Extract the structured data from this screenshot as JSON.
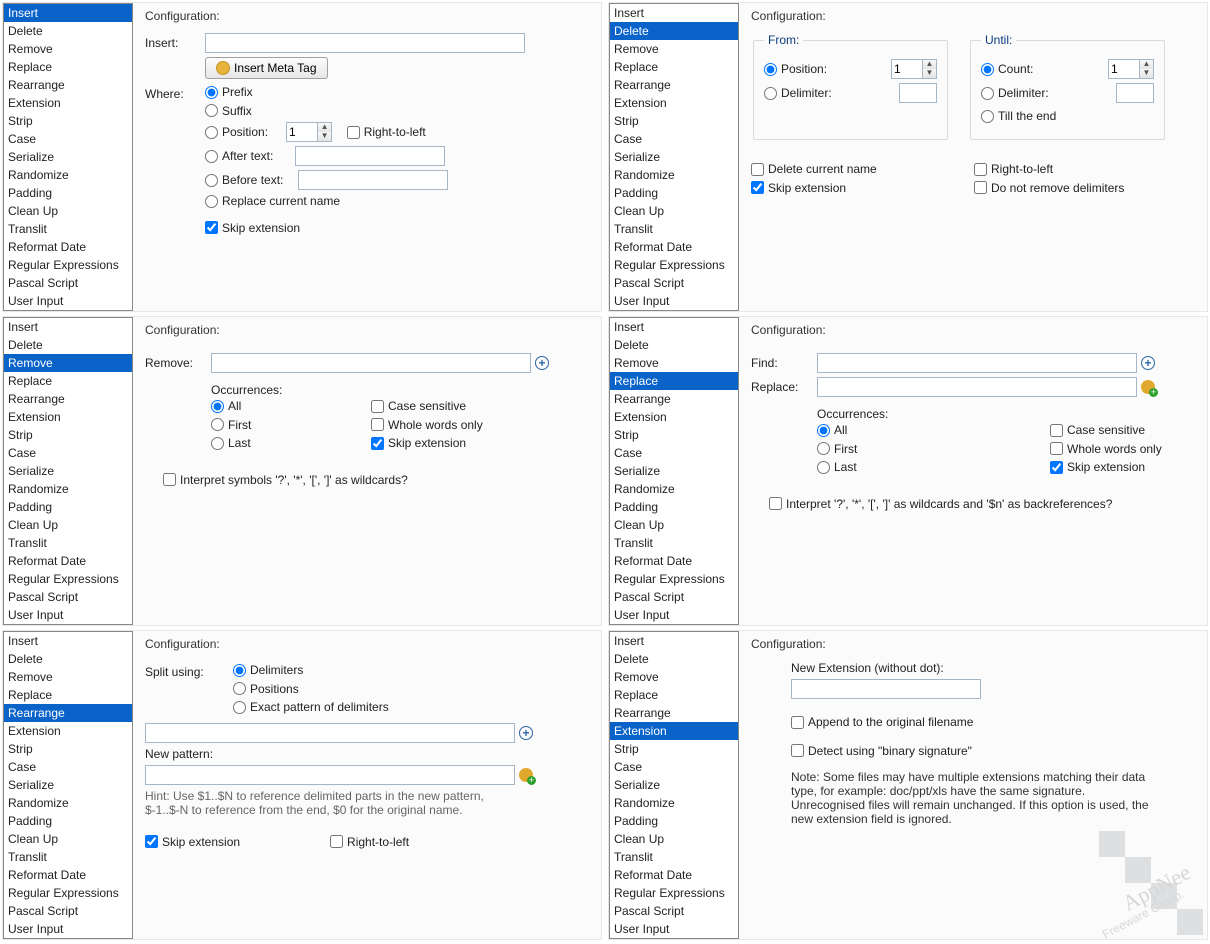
{
  "rule_items": [
    "Insert",
    "Delete",
    "Remove",
    "Replace",
    "Rearrange",
    "Extension",
    "Strip",
    "Case",
    "Serialize",
    "Randomize",
    "Padding",
    "Clean Up",
    "Translit",
    "Reformat Date",
    "Regular Expressions",
    "Pascal Script",
    "User Input"
  ],
  "panels": {
    "insert": {
      "title": "Configuration:",
      "lbl_insert": "Insert:",
      "btn_meta": "Insert Meta Tag",
      "lbl_where": "Where:",
      "opt_prefix": "Prefix",
      "opt_suffix": "Suffix",
      "opt_position": "Position:",
      "pos_val": "1",
      "chk_rtl": "Right-to-left",
      "opt_after": "After text:",
      "opt_before": "Before text:",
      "opt_replace_name": "Replace current name",
      "chk_skip_ext": "Skip extension"
    },
    "delete": {
      "title": "Configuration:",
      "grp_from": "From:",
      "grp_until": "Until:",
      "opt_position": "Position:",
      "from_val": "1",
      "opt_delimiter": "Delimiter:",
      "opt_count": "Count:",
      "until_val": "1",
      "opt_till_end": "Till the end",
      "chk_del_name": "Delete current name",
      "chk_skip_ext": "Skip extension",
      "chk_rtl": "Right-to-left",
      "chk_no_remove_delim": "Do not remove delimiters"
    },
    "remove": {
      "title": "Configuration:",
      "lbl_remove": "Remove:",
      "lbl_occ": "Occurrences:",
      "opt_all": "All",
      "opt_first": "First",
      "opt_last": "Last",
      "chk_case": "Case sensitive",
      "chk_whole": "Whole words only",
      "chk_skip_ext": "Skip extension",
      "chk_wild": "Interpret symbols '?', '*', '[', ']' as wildcards?"
    },
    "replace": {
      "title": "Configuration:",
      "lbl_find": "Find:",
      "lbl_replace": "Replace:",
      "lbl_occ": "Occurrences:",
      "opt_all": "All",
      "opt_first": "First",
      "opt_last": "Last",
      "chk_case": "Case sensitive",
      "chk_whole": "Whole words only",
      "chk_skip_ext": "Skip extension",
      "chk_wild": "Interpret '?', '*', '[', ']' as wildcards and '$n' as backreferences?"
    },
    "rearrange": {
      "title": "Configuration:",
      "lbl_split": "Split using:",
      "opt_delim": "Delimiters",
      "opt_pos": "Positions",
      "opt_exact": "Exact pattern of delimiters",
      "lbl_new": "New pattern:",
      "hint1": "Hint: Use $1..$N to reference delimited parts in the new pattern,",
      "hint2": "$-1..$-N to reference from the end, $0 for the original name.",
      "chk_skip_ext": "Skip extension",
      "chk_rtl": "Right-to-left"
    },
    "extension": {
      "title": "Configuration:",
      "lbl_newext": "New Extension (without dot):",
      "chk_append": "Append to the original filename",
      "chk_detect": "Detect using \"binary signature\"",
      "note": "Note: Some files may have multiple extensions matching their data type, for example: doc/ppt/xls have the same signature. Unrecognised files will remain unchanged. If this option is used, the new extension field is ignored."
    }
  },
  "selected": {
    "p0": "Insert",
    "p1": "Delete",
    "p2": "Remove",
    "p3": "Replace",
    "p4": "Rearrange",
    "p5": "Extension"
  },
  "watermark": {
    "t1": "AppNee",
    "t2": "Freeware Group."
  }
}
